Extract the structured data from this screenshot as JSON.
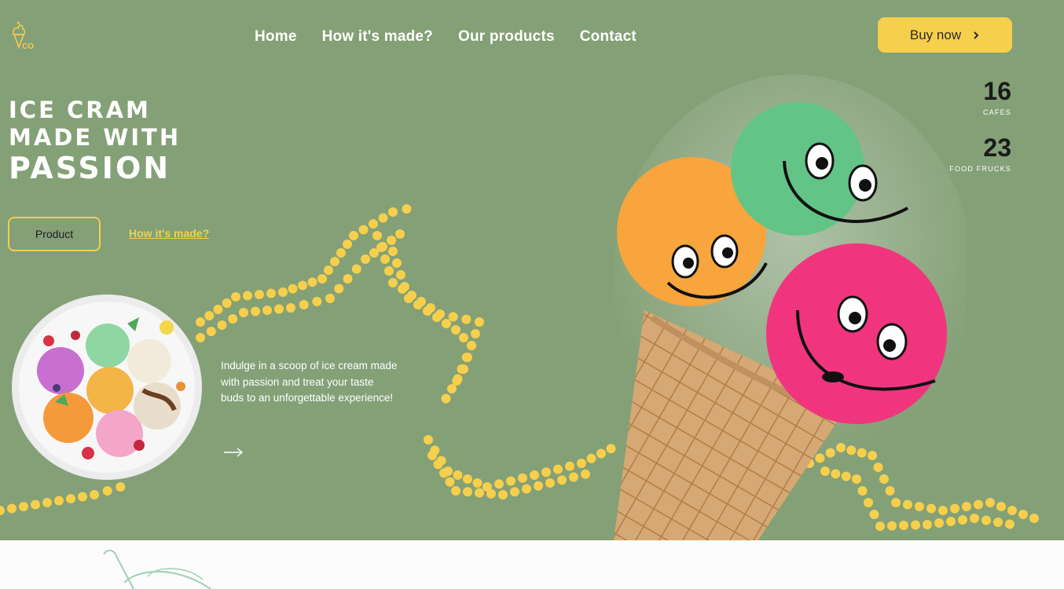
{
  "nav": {
    "items": [
      "Home",
      "How it's made?",
      "Our products",
      "Contact"
    ],
    "buy_label": "Buy now",
    "buy_icon": "chevron-right-icon"
  },
  "hero": {
    "headline": [
      "ICE CRAM",
      "MADE WITH",
      "PASSION"
    ],
    "product_button": "Product",
    "how_link": "How it's made?",
    "description": "Indulge in a scoop of ice cream made with passion and treat your taste buds to an unforgettable experience!",
    "arrow_icon": "arrow-right-icon"
  },
  "stats": [
    {
      "value": "16",
      "label": "CAFES"
    },
    {
      "value": "23",
      "label": "FOOD FRUCKS"
    }
  ],
  "colors": {
    "hero_background": "#84a077",
    "accent_yellow": "#f6cf4c",
    "scoop_green": "#62c487",
    "scoop_orange": "#f7a53c",
    "scoop_pink": "#f0357e",
    "cone": "#d6a874"
  }
}
